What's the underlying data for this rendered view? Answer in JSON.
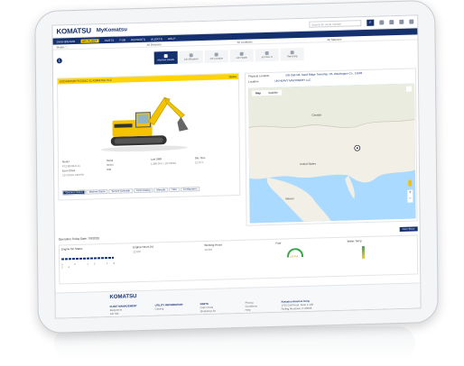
{
  "header": {
    "logo": "KOMATSU",
    "app_name": "MyKomatsu",
    "search_placeholder": "Search for serial number"
  },
  "nav": {
    "items": [
      "DASHBOARD",
      "MY FLEET",
      "PARTS",
      "PUB",
      "REPORTS",
      "ALERTS",
      "HELP"
    ],
    "active_index": 1
  },
  "filters": [
    "Model / ...",
    "All Divisions",
    "All Locations",
    "All Statuses"
  ],
  "section_number": "1",
  "tabs": [
    {
      "label": "Machine Details",
      "active": true
    },
    {
      "label": "Job Allocation",
      "active": false
    },
    {
      "label": "Job Location",
      "active": false
    },
    {
      "label": "Job Health",
      "active": false
    },
    {
      "label": "Job Hist. C",
      "active": false
    },
    {
      "label": "Reporting",
      "active": false
    }
  ],
  "machine": {
    "header_text": "EXCAVATOR PC210LC-11 KOMATSU PLC",
    "header_right": "Status",
    "specs": [
      {
        "label": "Model",
        "value": "PC138USLC-11"
      },
      {
        "label": "Serial",
        "value": "35000"
      },
      {
        "label": "Last SMR",
        "value": "1,680.00 h / 12/7/2019"
      },
      {
        "label": "Site Time",
        "value": "12:41 h"
      },
      {
        "label": "Econ Class",
        "value": "12/7/2019 1:30 PM"
      },
      {
        "label": "Unit",
        "value": ""
      }
    ],
    "actions": [
      "Operation Status",
      "Machine Status",
      "Service Schedule",
      "Parts Catalog",
      "Manuals",
      "Files",
      "Configuration"
    ]
  },
  "location": {
    "physical_label": "Physical Location",
    "physical_value": "505 Oak Rd, Sand Ridge Township, PA, Washington Co., 15006",
    "location_label": "Location",
    "location_value": "UN HEAVY MACHINERY LLC",
    "map_types": [
      "Map",
      "Satellite"
    ],
    "map_labels": [
      "United States",
      "Mexico",
      "Canada"
    ]
  },
  "operation": {
    "title": "Operation Today Date: 7/8/2020",
    "button": "View History",
    "columns": [
      {
        "label": "Engine On Status",
        "value": ""
      },
      {
        "label": "Engine Hours (h)",
        "value": "12,616"
      },
      {
        "label": "Working Hours",
        "value": "12,540"
      },
      {
        "label": "Fuel",
        "value": "1/2 Full"
      },
      {
        "label": "Water Temp",
        "value": ""
      }
    ],
    "tick_labels": [
      "0",
      "6",
      "12",
      "18",
      "24"
    ]
  },
  "footer": {
    "logo": "KOMATSU",
    "cols": [
      {
        "title": "FLEET MANAGEMENT",
        "lines": [
          "Equipment",
          "Job Site"
        ]
      },
      {
        "title": "UTILITY INFORMATION",
        "lines": [
          "Catalog"
        ]
      },
      {
        "title": "PARTS",
        "lines": [
          "Order Parts",
          "Shopping List"
        ]
      },
      {
        "title": "",
        "lines": [
          "Privacy",
          "Conditions",
          "Help"
        ]
      },
      {
        "title": "Komatsu America Corp.",
        "lines": [
          "1701 Golf Road, Suite 1-100",
          "Rolling Meadows, IL 60008"
        ]
      }
    ]
  },
  "colors": {
    "brand": "#14306f",
    "accent": "#ffd400"
  }
}
